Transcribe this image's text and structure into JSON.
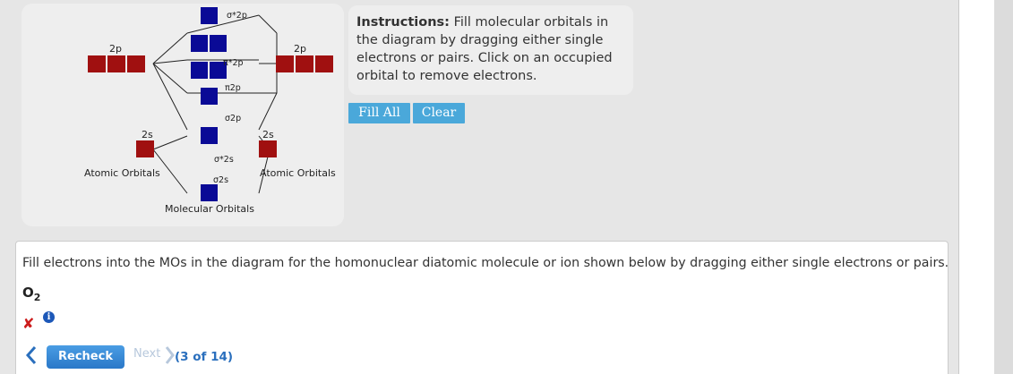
{
  "diagram": {
    "labels": {
      "left_2p": "2p",
      "right_2p": "2p",
      "left_2s": "2s",
      "right_2s": "2s",
      "atomic_left": "Atomic Orbitals",
      "atomic_right": "Atomic Orbitals",
      "molecular": "Molecular Orbitals",
      "sigma_star_2p": "σ*2p",
      "pi_star_2p": "π*2p",
      "pi_2p": "π2p",
      "sigma_2p": "σ2p",
      "sigma_star_2s": "σ*2s",
      "sigma_2s": "σ2s"
    },
    "colors": {
      "atomic_orbital": "#a01010",
      "molecular_orbital": "#0a0a96",
      "tool": "#1d74b8"
    }
  },
  "tools": {
    "single_icon": "single-electron-arrow-icon",
    "pair_icon": "electron-pair-arrows-icon"
  },
  "instructions": {
    "label": "Instructions:",
    "text": " Fill molecular orbitals in the diagram by dragging either single electrons or pairs. Click on an occupied orbital to remove electrons."
  },
  "buttons": {
    "fill_all": "Fill All",
    "clear": "Clear"
  },
  "question": {
    "text": "Fill electrons into the MOs in the diagram for the homonuclear diatomic molecule or ion shown below by dragging either single electrons or pairs.",
    "formula_base": "O",
    "formula_sub": "2",
    "status_icon": "x-mark-icon",
    "info_icon": "info-icon"
  },
  "nav": {
    "recheck": "Recheck",
    "next": "Next",
    "progress": "(3 of 14)"
  }
}
